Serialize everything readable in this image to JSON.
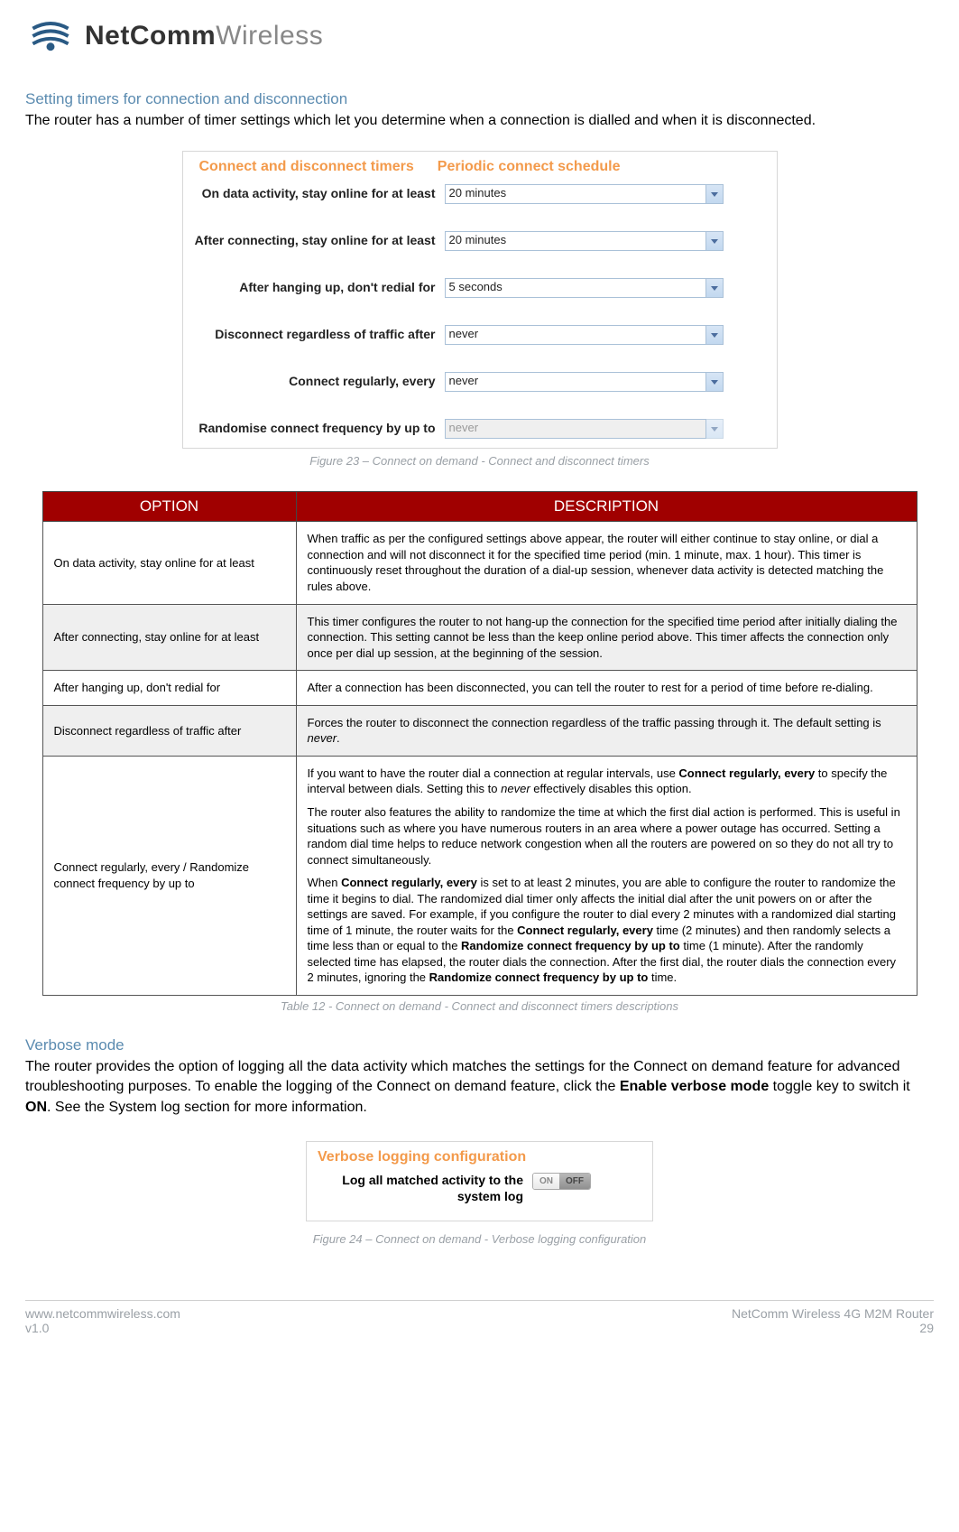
{
  "brand": {
    "bold": "NetComm",
    "light": "Wireless"
  },
  "section1": {
    "heading": "Setting timers for connection and disconnection",
    "body": "The router has a number of timer settings which let you determine when a connection is dialled and when it is disconnected."
  },
  "timers": {
    "tabs": [
      "Connect and disconnect timers",
      "Periodic connect schedule"
    ],
    "rows": [
      {
        "label": "On data activity, stay online for at least",
        "value": "20 minutes",
        "disabled": false
      },
      {
        "label": "After connecting, stay online for at least",
        "value": "20 minutes",
        "disabled": false
      },
      {
        "label": "After hanging up, don't redial for",
        "value": "5 seconds",
        "disabled": false
      },
      {
        "label": "Disconnect regardless of traffic after",
        "value": "never",
        "disabled": false
      },
      {
        "label": "Connect regularly, every",
        "value": "never",
        "disabled": false
      },
      {
        "label": "Randomise connect frequency by up to",
        "value": "never",
        "disabled": true
      }
    ]
  },
  "figure23": "Figure 23 – Connect on demand - Connect and disconnect timers",
  "table": {
    "headers": [
      "OPTION",
      "DESCRIPTION"
    ],
    "rows": [
      {
        "option": "On data activity, stay online for at least",
        "desc": "When traffic as per the configured settings above appear, the router will either continue to stay online, or dial a connection and will not disconnect it for the specified time period (min. 1 minute, max. 1 hour). This timer is continuously reset throughout the duration of a dial-up session, whenever data activity is detected matching the rules above."
      },
      {
        "option": "After connecting, stay online for at least",
        "desc": "This timer configures the router to not hang-up the connection for the specified time period after initially dialing the connection. This setting cannot be less than the keep online period above. This timer affects the connection only once per dial up session, at the beginning of the session."
      },
      {
        "option": "After hanging up, don't redial for",
        "desc": "After a connection has been disconnected, you can tell the router to rest for a period of time before re-dialing."
      },
      {
        "option": "Disconnect regardless of traffic after",
        "desc_pre": "Forces the router to disconnect the connection regardless of the traffic passing through it. The default setting is ",
        "desc_ital": "never",
        "desc_post": "."
      },
      {
        "option": "Connect regularly, every / Randomize connect frequency by up to",
        "p1_pre": "If you want to have the router dial a connection at regular intervals, use ",
        "p1_bold": "Connect regularly, every",
        "p1_mid": " to specify the interval between dials. Setting this to ",
        "p1_ital": "never",
        "p1_post": " effectively disables this option.",
        "p2": "The router also features the ability to randomize the time at which the first dial action is performed. This is useful in situations such as where you have numerous routers in an area where a power outage has occurred. Setting a random dial time helps to reduce network congestion when all the routers are powered on so they do not all try to connect simultaneously.",
        "p3_a": "When ",
        "p3_b1": "Connect regularly, every",
        "p3_b": " is set to at least 2 minutes, you are able to configure the router to randomize the time it begins to dial. The randomized dial timer only affects the initial dial after the unit powers on or after the settings are saved. For example, if you configure the router to dial every 2 minutes with a randomized dial starting time of 1 minute, the router waits for the ",
        "p3_b2": "Connect regularly, every",
        "p3_c": " time (2 minutes) and then randomly selects a time less than or equal to the ",
        "p3_b3": "Randomize connect frequency by up to",
        "p3_d": "  time (1 minute). After the randomly selected time has elapsed, the router dials the connection. After the first dial, the router dials the connection every 2 minutes, ignoring the ",
        "p3_b4": "Randomize connect frequency by up to",
        "p3_e": " time."
      }
    ]
  },
  "table_caption": "Table 12 - Connect on demand - Connect and disconnect timers descriptions",
  "section2": {
    "heading": "Verbose mode",
    "body_a": "The router provides the option of logging all the data activity which matches the settings for the Connect on demand feature for advanced troubleshooting purposes. To enable the logging of the Connect on demand feature, click the ",
    "body_b1": "Enable verbose mode",
    "body_b": " toggle key to switch it ",
    "body_b2": "ON",
    "body_c": ". See the System log section for more information."
  },
  "verbose": {
    "title": "Verbose logging configuration",
    "label": "Log all matched activity to the system log",
    "on": "ON",
    "off": "OFF"
  },
  "figure24": "Figure 24 – Connect on demand - Verbose logging configuration",
  "footer": {
    "url": "www.netcommwireless.com",
    "version": "v1.0",
    "product": "NetComm Wireless 4G M2M Router",
    "page": "29"
  }
}
